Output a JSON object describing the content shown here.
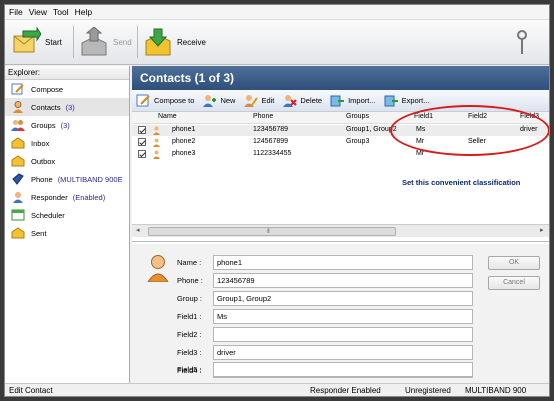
{
  "menu": [
    "File",
    "View",
    "Tool",
    "Help"
  ],
  "toolbar": {
    "start": "Start",
    "send": "Send",
    "receive": "Receive"
  },
  "explorer": {
    "header": "Explorer:",
    "items": [
      {
        "label": "Compose",
        "count": ""
      },
      {
        "label": "Contacts",
        "count": "(3)"
      },
      {
        "label": "Groups",
        "count": "(3)"
      },
      {
        "label": "Inbox",
        "count": ""
      },
      {
        "label": "Outbox",
        "count": ""
      },
      {
        "label": "Phone",
        "count": "(MULTIBAND 900E"
      },
      {
        "label": "Responder",
        "count": "(Enabled)"
      },
      {
        "label": "Scheduler",
        "count": ""
      },
      {
        "label": "Sent",
        "count": ""
      }
    ]
  },
  "contacts": {
    "title": "Contacts (1 of 3)",
    "toolbar": [
      "Compose to",
      "New",
      "Edit",
      "Delete",
      "Import...",
      "Export..."
    ],
    "columns": [
      "Name",
      "Phone",
      "Groups",
      "Field1",
      "Field2",
      "Field3"
    ],
    "rows": [
      {
        "name": "phone1",
        "phone": "123456789",
        "groups": "Group1, Group2",
        "field1": "Ms",
        "field2": "",
        "field3": "driver"
      },
      {
        "name": "phone2",
        "phone": "124567899",
        "groups": "Group3",
        "field1": "Mr",
        "field2": "Seller",
        "field3": ""
      },
      {
        "name": "phone3",
        "phone": "1122334455",
        "groups": "",
        "field1": "Mr",
        "field2": "",
        "field3": ""
      }
    ],
    "annotation": "Set this convenient classification"
  },
  "editor": {
    "labels": [
      "Name :",
      "Phone :",
      "Group :",
      "Field1 :",
      "Field2 :",
      "Field3 :",
      "Field4 :",
      "Field5 :"
    ],
    "values": [
      "phone1",
      "123456789",
      "Group1, Group2",
      "Ms",
      "",
      "driver",
      "",
      ""
    ],
    "ok": "OK",
    "cancel": "Cancel"
  },
  "status": {
    "left": "Edit Contact",
    "responder": "Responder Enabled",
    "reg": "Unregistered",
    "modem": "MULTIBAND  900"
  },
  "colors": {
    "title_bar": "#3a5c88",
    "annotation_circle": "#d81b1b",
    "annotation_text": "#0a2a6a"
  }
}
